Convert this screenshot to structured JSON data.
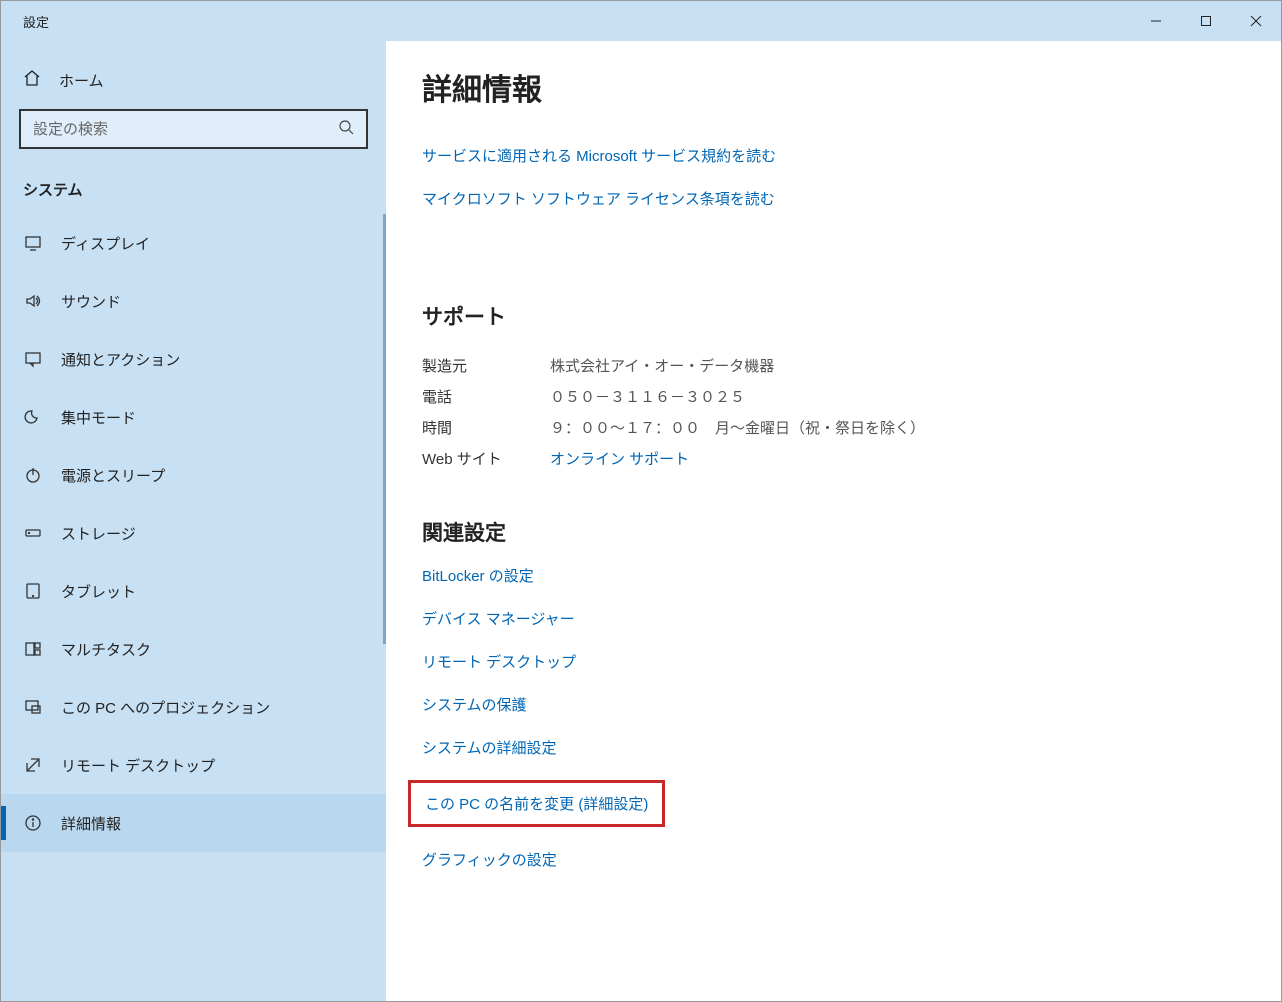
{
  "window": {
    "title": "設定"
  },
  "sidebar": {
    "home": "ホーム",
    "search_placeholder": "設定の検索",
    "category": "システム",
    "items": [
      {
        "label": "ディスプレイ"
      },
      {
        "label": "サウンド"
      },
      {
        "label": "通知とアクション"
      },
      {
        "label": "集中モード"
      },
      {
        "label": "電源とスリープ"
      },
      {
        "label": "ストレージ"
      },
      {
        "label": "タブレット"
      },
      {
        "label": "マルチタスク"
      },
      {
        "label": "この PC へのプロジェクション"
      },
      {
        "label": "リモート デスクトップ"
      },
      {
        "label": "詳細情報"
      }
    ]
  },
  "page": {
    "title": "詳細情報",
    "top_links": [
      "サービスに適用される Microsoft サービス規約を読む",
      "マイクロソフト ソフトウェア ライセンス条項を読む"
    ],
    "support": {
      "heading": "サポート",
      "manufacturer_label": "製造元",
      "manufacturer_value": "株式会社アイ・オー・データ機器",
      "phone_label": "電話",
      "phone_value": "０５０－３１１６－３０２５",
      "hours_label": "時間",
      "hours_value": "９：００～１７：００　月～金曜日（祝・祭日を除く）",
      "website_label": "Web サイト",
      "website_value": "オンライン サポート"
    },
    "related": {
      "heading": "関連設定",
      "links": [
        "BitLocker の設定",
        "デバイス マネージャー",
        "リモート デスクトップ",
        "システムの保護",
        "システムの詳細設定",
        "この PC の名前を変更 (詳細設定)",
        "グラフィックの設定"
      ],
      "highlighted_index": 5
    }
  }
}
